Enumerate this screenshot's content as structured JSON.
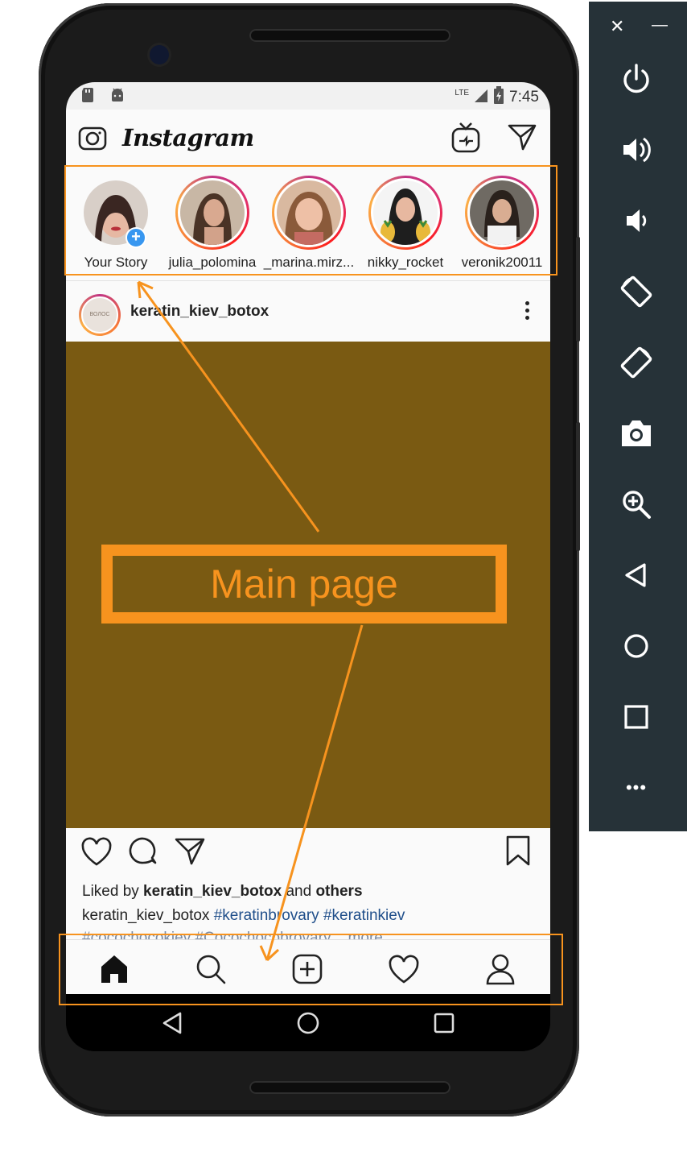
{
  "status_bar": {
    "network": "LTE",
    "time": "7:45"
  },
  "app": {
    "name": "Instagram"
  },
  "stories": [
    {
      "name": "Your Story",
      "own": true
    },
    {
      "name": "julia_polomina",
      "own": false
    },
    {
      "name": "_marina.mirz...",
      "own": false
    },
    {
      "name": "nikky_rocket",
      "own": false
    },
    {
      "name": "veronik20011",
      "own": false
    }
  ],
  "post": {
    "username": "keratin_kiev_botox",
    "avatar_text": "ВОЛОС",
    "image_color": "#7a5a12",
    "liked_prefix": "Liked by ",
    "liked_user": "keratin_kiev_botox",
    "liked_mid": " and ",
    "liked_suffix": "others",
    "caption_user": "keratin_kiev_botox",
    "caption_tags": " #keratinbrovary #keratinkiev",
    "caption_cut": "#cocochocokiev #Cocochocobrovary ...more"
  },
  "annotation": {
    "label": "Main page",
    "color": "#f7931e"
  },
  "emulator": {
    "close_glyph": "✕",
    "minimize_glyph": "—",
    "more_glyph": "•••"
  }
}
